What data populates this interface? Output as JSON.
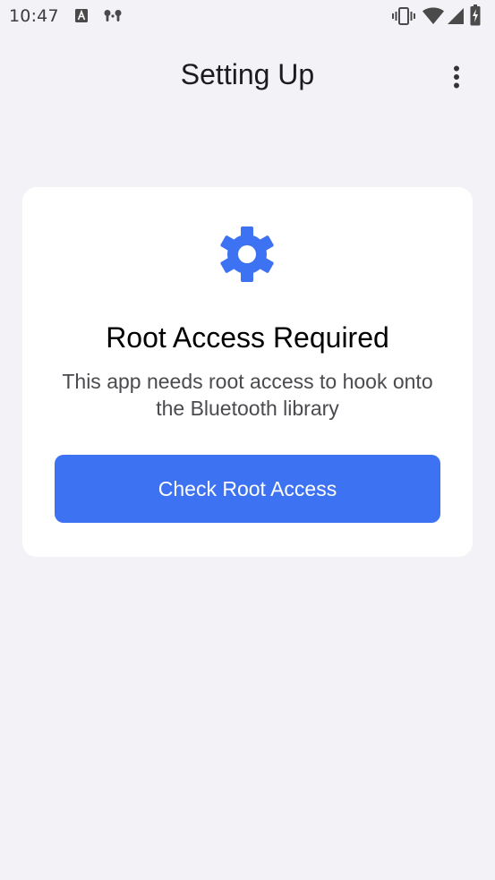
{
  "status_bar": {
    "time": "10:47",
    "icons": [
      "text-a-icon",
      "earbuds-icon",
      "vibrate-icon",
      "wifi-icon",
      "cell-signal-icon",
      "battery-charging-icon"
    ]
  },
  "app_bar": {
    "title": "Setting Up",
    "overflow_icon": "more-vert-icon"
  },
  "card": {
    "icon": "gear-icon",
    "title": "Root Access Required",
    "description": "This app needs root access to hook onto the Bluetooth library",
    "button_label": "Check Root Access"
  },
  "colors": {
    "background": "#f2f2f7",
    "card": "#ffffff",
    "accent": "#3d72f2",
    "title_text": "#1c1c1e",
    "secondary_text": "#4a4a4f"
  }
}
